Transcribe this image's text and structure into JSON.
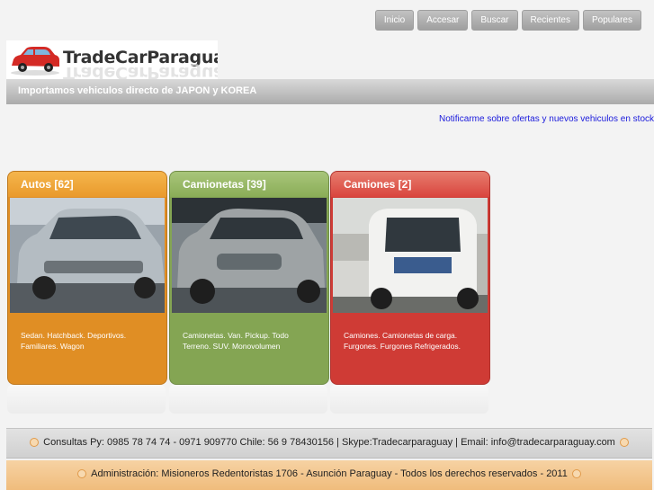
{
  "nav": {
    "items": [
      "Inicio",
      "Accesar",
      "Buscar",
      "Recientes",
      "Populares"
    ]
  },
  "logo": {
    "text": "TradeCarParaguay"
  },
  "tagline": "Importamos vehiculos directo de JAPON y KOREA",
  "notify_link": "Notificarme sobre ofertas y nuevos vehiculos en stock",
  "cards": [
    {
      "title": "Autos [62]",
      "desc": "Sedan. Hatchback. Deportivos. Familiares. Wagon",
      "color": "#e99a2c"
    },
    {
      "title": "Camionetas [39]",
      "desc": "Camionetas. Van. Pickup. Todo Terreno. SUV. Monovolumen",
      "color": "#8aad57"
    },
    {
      "title": "Camiones [2]",
      "desc": "Camiones. Camionetas de carga. Furgones. Furgones Refrigerados.",
      "color": "#d9453e"
    }
  ],
  "footer": {
    "contact": "Consultas Py: 0985 78 74 74 - 0971 909770  Chile: 56 9 78430156 | Skype:Tradecarparaguay | Email: info@tradecarparaguay.com",
    "admin": "Administración: Misioneros Redentoristas 1706 - Asunción  Paraguay -  Todos los derechos reservados - 2011"
  }
}
